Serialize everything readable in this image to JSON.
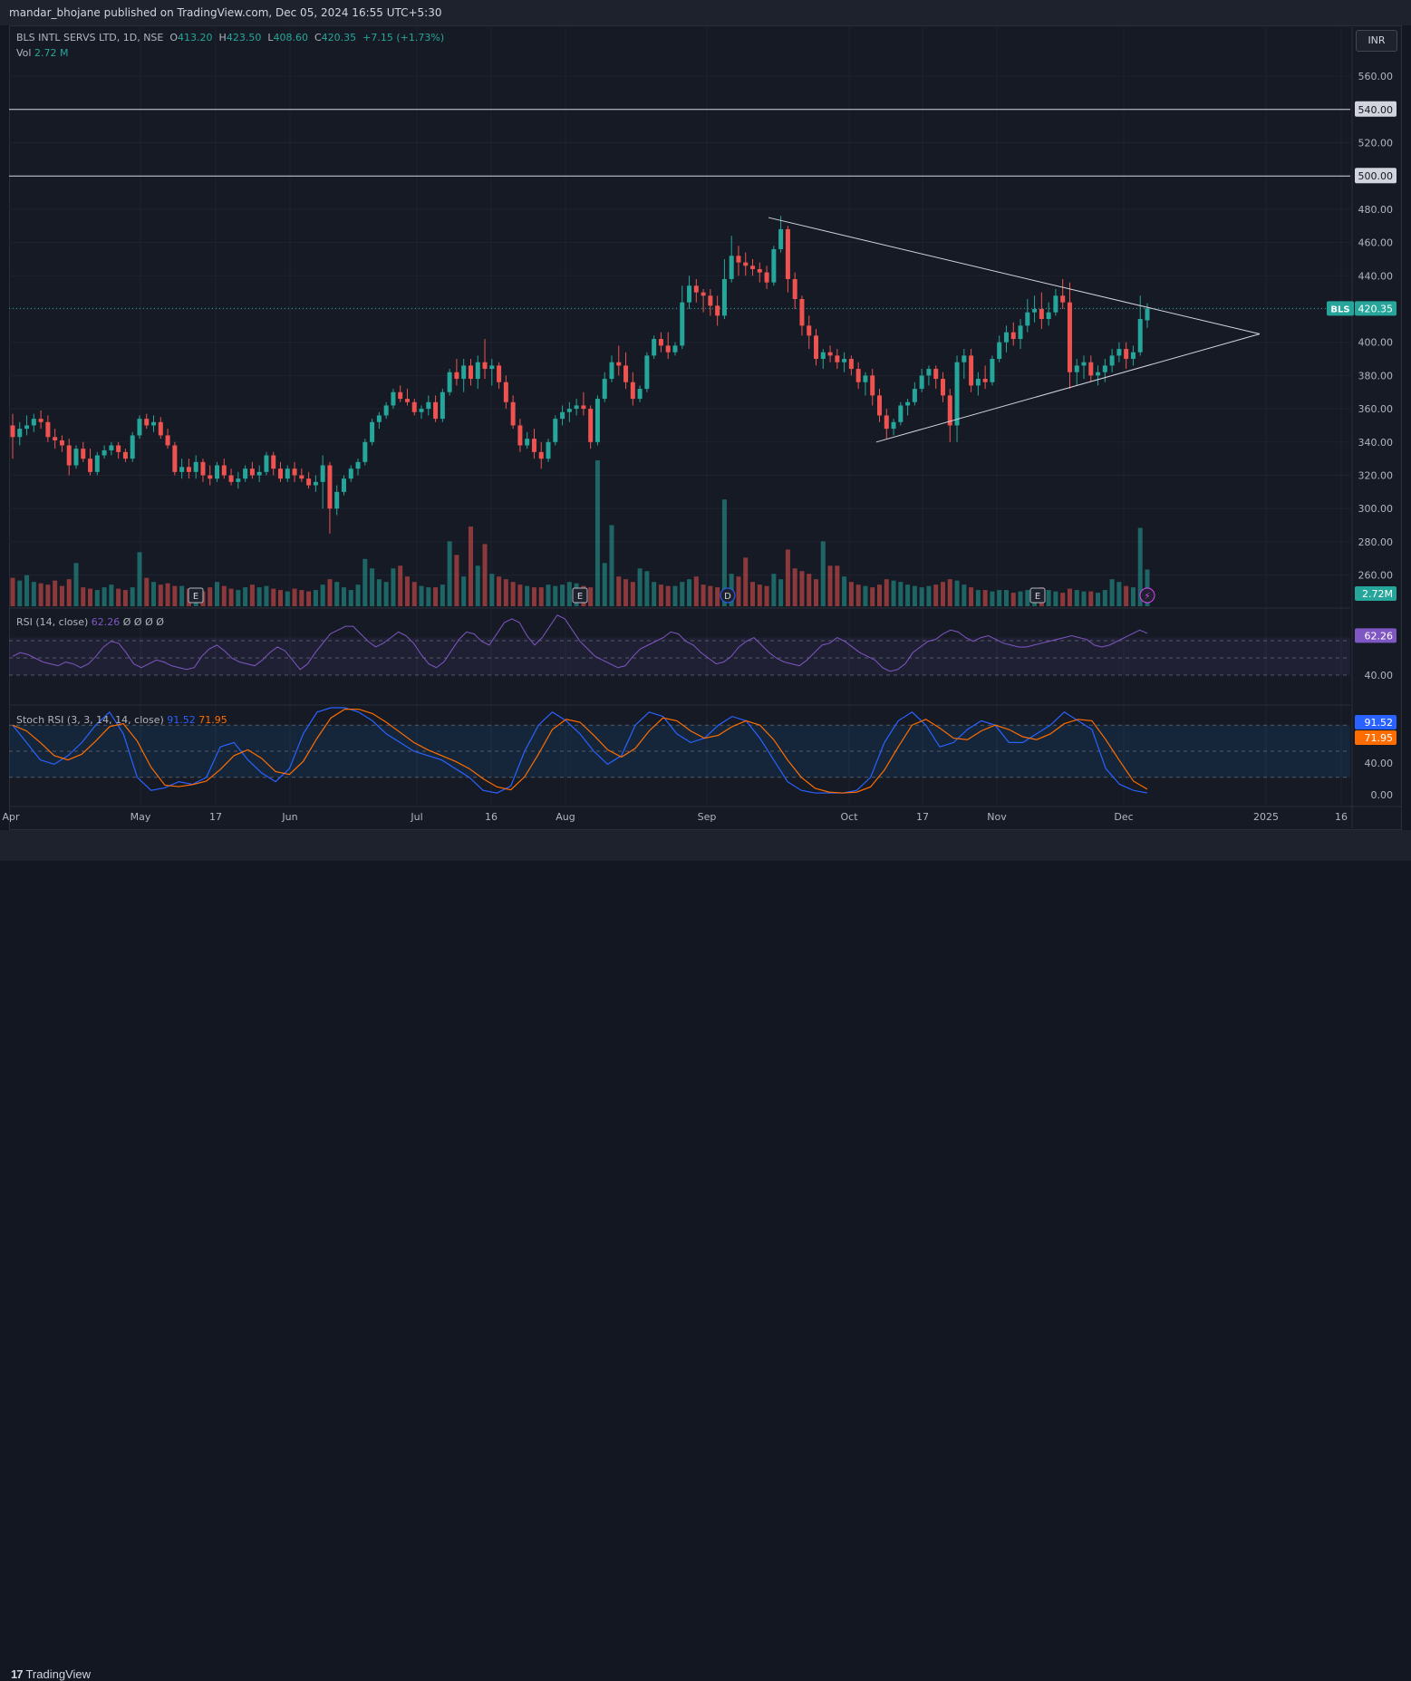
{
  "publisher": "mandar_bhojane published on TradingView.com, Dec 05, 2024 16:55 UTC+5:30",
  "currency_button": "INR",
  "footer_logo": "TradingView",
  "legend": {
    "symbol": "BLS INTL SERVS LTD, 1D, NSE",
    "o_label": "O",
    "o_value": "413.20",
    "h_label": "H",
    "h_value": "423.50",
    "l_label": "L",
    "l_value": "408.60",
    "c_label": "C",
    "c_value": "420.35",
    "change": "+7.15 (+1.73%)",
    "vol_label": "Vol",
    "vol_value": "2.72 M"
  },
  "rsi_legend": {
    "label": "RSI (14, close)",
    "value": "62.26",
    "extra": "Ø Ø Ø Ø"
  },
  "stoch_legend": {
    "label": "Stoch RSI (3, 3, 14, 14, close)",
    "k_value": "91.52",
    "d_value": "71.95"
  },
  "colors": {
    "up": "#26a69a",
    "down": "#ef5350",
    "rsi": "#7e57c2",
    "stoch_k": "#2962ff",
    "stoch_d": "#ff6d00",
    "price_tag": "#26a69a"
  },
  "chart_data": {
    "type": "candlestick",
    "symbol_tag": "BLS",
    "last_price": "420.35",
    "volume_tag": "2.72M",
    "price_axis_ticks": [
      "560.00",
      "540.00",
      "520.00",
      "500.00",
      "480.00",
      "460.00",
      "440.00",
      "420.00",
      "400.00",
      "380.00",
      "360.00",
      "340.00",
      "320.00",
      "300.00",
      "280.00",
      "260.00"
    ],
    "price_axis_values": [
      560,
      540,
      520,
      500,
      480,
      460,
      440,
      420,
      400,
      380,
      360,
      340,
      320,
      300,
      280,
      260
    ],
    "highlighted_levels": [
      "540.00",
      "500.00"
    ],
    "x_axis_labels": [
      "Apr",
      "May",
      "17",
      "Jun",
      "Jul",
      "16",
      "Aug",
      "Sep",
      "Oct",
      "17",
      "Nov",
      "Dec",
      "2025",
      "16"
    ],
    "events": [
      "E",
      "E",
      "D",
      "E"
    ],
    "triangle": {
      "upper": [
        [
          "Sep 11",
          475
        ],
        [
          "Dec 31",
          405
        ]
      ],
      "lower": [
        [
          "Oct 7",
          340
        ],
        [
          "Dec 31",
          405
        ]
      ]
    },
    "candles": [
      [
        350,
        357,
        330,
        343
      ],
      [
        343,
        352,
        338,
        348
      ],
      [
        348,
        356,
        344,
        350
      ],
      [
        350,
        357,
        346,
        354
      ],
      [
        354,
        359,
        348,
        352
      ],
      [
        352,
        356,
        340,
        343
      ],
      [
        343,
        348,
        336,
        341
      ],
      [
        341,
        344,
        334,
        338
      ],
      [
        338,
        342,
        320,
        326
      ],
      [
        326,
        338,
        324,
        336
      ],
      [
        336,
        340,
        328,
        330
      ],
      [
        330,
        336,
        320,
        322
      ],
      [
        322,
        334,
        320,
        332
      ],
      [
        332,
        338,
        330,
        335
      ],
      [
        335,
        340,
        332,
        338
      ],
      [
        338,
        340,
        330,
        334
      ],
      [
        334,
        336,
        328,
        330
      ],
      [
        330,
        346,
        328,
        344
      ],
      [
        344,
        356,
        342,
        354
      ],
      [
        354,
        357,
        348,
        350
      ],
      [
        350,
        356,
        346,
        352
      ],
      [
        352,
        355,
        342,
        344
      ],
      [
        344,
        348,
        336,
        338
      ],
      [
        338,
        340,
        320,
        322
      ],
      [
        322,
        330,
        318,
        325
      ],
      [
        325,
        330,
        318,
        322
      ],
      [
        322,
        332,
        318,
        328
      ],
      [
        328,
        330,
        316,
        320
      ],
      [
        320,
        326,
        314,
        318
      ],
      [
        318,
        328,
        316,
        326
      ],
      [
        326,
        330,
        318,
        320
      ],
      [
        320,
        324,
        314,
        316
      ],
      [
        316,
        322,
        312,
        318
      ],
      [
        318,
        326,
        316,
        324
      ],
      [
        324,
        328,
        318,
        320
      ],
      [
        320,
        326,
        316,
        322
      ],
      [
        322,
        334,
        320,
        332
      ],
      [
        332,
        334,
        320,
        324
      ],
      [
        324,
        328,
        316,
        318
      ],
      [
        318,
        326,
        316,
        324
      ],
      [
        324,
        328,
        316,
        320
      ],
      [
        320,
        324,
        316,
        318
      ],
      [
        318,
        322,
        312,
        314
      ],
      [
        314,
        320,
        310,
        316
      ],
      [
        316,
        332,
        300,
        326
      ],
      [
        326,
        328,
        285,
        300
      ],
      [
        300,
        314,
        296,
        310
      ],
      [
        310,
        320,
        308,
        318
      ],
      [
        318,
        326,
        316,
        324
      ],
      [
        324,
        330,
        320,
        328
      ],
      [
        328,
        342,
        326,
        340
      ],
      [
        340,
        354,
        338,
        352
      ],
      [
        352,
        358,
        348,
        356
      ],
      [
        356,
        364,
        354,
        362
      ],
      [
        362,
        372,
        360,
        370
      ],
      [
        370,
        374,
        364,
        366
      ],
      [
        366,
        372,
        362,
        364
      ],
      [
        364,
        366,
        356,
        358
      ],
      [
        358,
        362,
        354,
        360
      ],
      [
        360,
        368,
        356,
        364
      ],
      [
        364,
        368,
        352,
        354
      ],
      [
        354,
        372,
        352,
        370
      ],
      [
        370,
        384,
        368,
        382
      ],
      [
        382,
        390,
        374,
        378
      ],
      [
        378,
        390,
        370,
        386
      ],
      [
        386,
        390,
        374,
        378
      ],
      [
        378,
        392,
        372,
        388
      ],
      [
        388,
        402,
        378,
        384
      ],
      [
        384,
        390,
        374,
        386
      ],
      [
        386,
        388,
        372,
        376
      ],
      [
        376,
        380,
        360,
        364
      ],
      [
        364,
        368,
        348,
        350
      ],
      [
        350,
        354,
        334,
        338
      ],
      [
        338,
        346,
        336,
        342
      ],
      [
        342,
        348,
        330,
        334
      ],
      [
        334,
        340,
        324,
        330
      ],
      [
        330,
        342,
        328,
        340
      ],
      [
        340,
        356,
        338,
        354
      ],
      [
        354,
        362,
        350,
        358
      ],
      [
        358,
        364,
        352,
        360
      ],
      [
        360,
        366,
        356,
        362
      ],
      [
        362,
        370,
        356,
        360
      ],
      [
        360,
        362,
        336,
        340
      ],
      [
        340,
        368,
        338,
        366
      ],
      [
        366,
        382,
        364,
        378
      ],
      [
        378,
        392,
        376,
        388
      ],
      [
        388,
        398,
        380,
        386
      ],
      [
        386,
        394,
        372,
        376
      ],
      [
        376,
        382,
        362,
        366
      ],
      [
        366,
        374,
        364,
        372
      ],
      [
        372,
        394,
        370,
        392
      ],
      [
        392,
        404,
        390,
        402
      ],
      [
        402,
        406,
        394,
        398
      ],
      [
        398,
        406,
        390,
        394
      ],
      [
        394,
        400,
        392,
        398
      ],
      [
        398,
        434,
        396,
        424
      ],
      [
        424,
        440,
        420,
        434
      ],
      [
        434,
        438,
        424,
        430
      ],
      [
        430,
        432,
        418,
        428
      ],
      [
        428,
        432,
        416,
        422
      ],
      [
        422,
        428,
        410,
        416
      ],
      [
        416,
        450,
        414,
        438
      ],
      [
        438,
        464,
        436,
        452
      ],
      [
        452,
        458,
        440,
        448
      ],
      [
        448,
        454,
        440,
        446
      ],
      [
        446,
        450,
        440,
        444
      ],
      [
        444,
        448,
        436,
        442
      ],
      [
        442,
        446,
        432,
        436
      ],
      [
        436,
        458,
        434,
        456
      ],
      [
        456,
        476,
        454,
        468
      ],
      [
        468,
        470,
        430,
        438
      ],
      [
        438,
        442,
        420,
        426
      ],
      [
        426,
        428,
        404,
        410
      ],
      [
        410,
        416,
        396,
        404
      ],
      [
        404,
        408,
        386,
        390
      ],
      [
        390,
        396,
        384,
        394
      ],
      [
        394,
        398,
        388,
        392
      ],
      [
        392,
        396,
        384,
        388
      ],
      [
        388,
        394,
        382,
        390
      ],
      [
        390,
        392,
        380,
        384
      ],
      [
        384,
        388,
        372,
        376
      ],
      [
        376,
        382,
        368,
        380
      ],
      [
        380,
        384,
        362,
        368
      ],
      [
        368,
        372,
        352,
        356
      ],
      [
        356,
        360,
        342,
        348
      ],
      [
        348,
        354,
        344,
        352
      ],
      [
        352,
        364,
        350,
        362
      ],
      [
        362,
        366,
        356,
        364
      ],
      [
        364,
        376,
        362,
        372
      ],
      [
        372,
        384,
        370,
        380
      ],
      [
        380,
        386,
        374,
        384
      ],
      [
        384,
        386,
        372,
        378
      ],
      [
        378,
        382,
        364,
        368
      ],
      [
        368,
        372,
        340,
        350
      ],
      [
        350,
        392,
        340,
        388
      ],
      [
        388,
        396,
        378,
        392
      ],
      [
        392,
        396,
        370,
        374
      ],
      [
        374,
        382,
        368,
        378
      ],
      [
        378,
        386,
        372,
        376
      ],
      [
        376,
        392,
        374,
        390
      ],
      [
        390,
        404,
        388,
        400
      ],
      [
        400,
        410,
        394,
        406
      ],
      [
        406,
        412,
        398,
        402
      ],
      [
        402,
        414,
        396,
        410
      ],
      [
        410,
        426,
        406,
        418
      ],
      [
        418,
        428,
        412,
        420
      ],
      [
        420,
        430,
        408,
        414
      ],
      [
        414,
        424,
        410,
        418
      ],
      [
        418,
        432,
        416,
        428
      ],
      [
        428,
        438,
        420,
        424
      ],
      [
        424,
        436,
        372,
        382
      ],
      [
        382,
        390,
        374,
        386
      ],
      [
        386,
        392,
        378,
        388
      ],
      [
        388,
        392,
        376,
        380
      ],
      [
        380,
        386,
        374,
        382
      ],
      [
        382,
        390,
        376,
        386
      ],
      [
        386,
        396,
        382,
        392
      ],
      [
        392,
        400,
        388,
        396
      ],
      [
        396,
        400,
        384,
        390
      ],
      [
        390,
        398,
        386,
        394
      ],
      [
        394,
        428,
        392,
        414
      ],
      [
        413.2,
        423.5,
        408.6,
        420.35
      ]
    ],
    "volumes": [
      2.1,
      1.9,
      2.3,
      1.8,
      1.7,
      1.6,
      1.9,
      1.5,
      2.0,
      3.2,
      1.4,
      1.3,
      1.2,
      1.4,
      1.6,
      1.3,
      1.2,
      1.4,
      4.0,
      2.1,
      1.8,
      1.6,
      1.7,
      1.5,
      1.5,
      1.3,
      1.2,
      1.1,
      1.4,
      1.8,
      1.5,
      1.3,
      1.2,
      1.4,
      1.6,
      1.4,
      1.5,
      1.3,
      1.2,
      1.1,
      1.3,
      1.2,
      1.1,
      1.2,
      1.6,
      2.0,
      1.8,
      1.4,
      1.2,
      1.6,
      3.5,
      2.8,
      2.0,
      1.8,
      2.8,
      3.0,
      2.2,
      1.8,
      1.5,
      1.4,
      1.4,
      1.6,
      4.8,
      3.8,
      2.2,
      5.9,
      3.0,
      4.6,
      2.4,
      2.2,
      2.0,
      1.8,
      1.6,
      1.5,
      1.4,
      1.4,
      1.6,
      1.5,
      1.6,
      1.8,
      1.7,
      1.5,
      1.4,
      10.8,
      3.2,
      6.0,
      2.2,
      2.0,
      1.8,
      2.8,
      2.6,
      1.8,
      1.6,
      1.5,
      1.5,
      1.8,
      2.0,
      2.2,
      1.6,
      1.5,
      1.4,
      7.9,
      2.4,
      2.2,
      3.6,
      1.8,
      1.6,
      1.5,
      2.4,
      2.0,
      4.2,
      2.8,
      2.6,
      2.4,
      2.0,
      4.8,
      3.0,
      3.0,
      2.2,
      1.8,
      1.6,
      1.5,
      1.4,
      1.6,
      2.0,
      1.9,
      1.8,
      1.6,
      1.5,
      1.4,
      1.5,
      1.6,
      1.8,
      2.0,
      1.9,
      1.6,
      1.4,
      1.2,
      1.2,
      1.1,
      1.2,
      1.2,
      1.0,
      1.1,
      1.2,
      1.3,
      1.4,
      1.2,
      1.1,
      1.0,
      1.3,
      1.2,
      1.1,
      1.1,
      1.0,
      1.2,
      2.0,
      1.8,
      1.5,
      1.4,
      5.8,
      2.72
    ]
  }
}
